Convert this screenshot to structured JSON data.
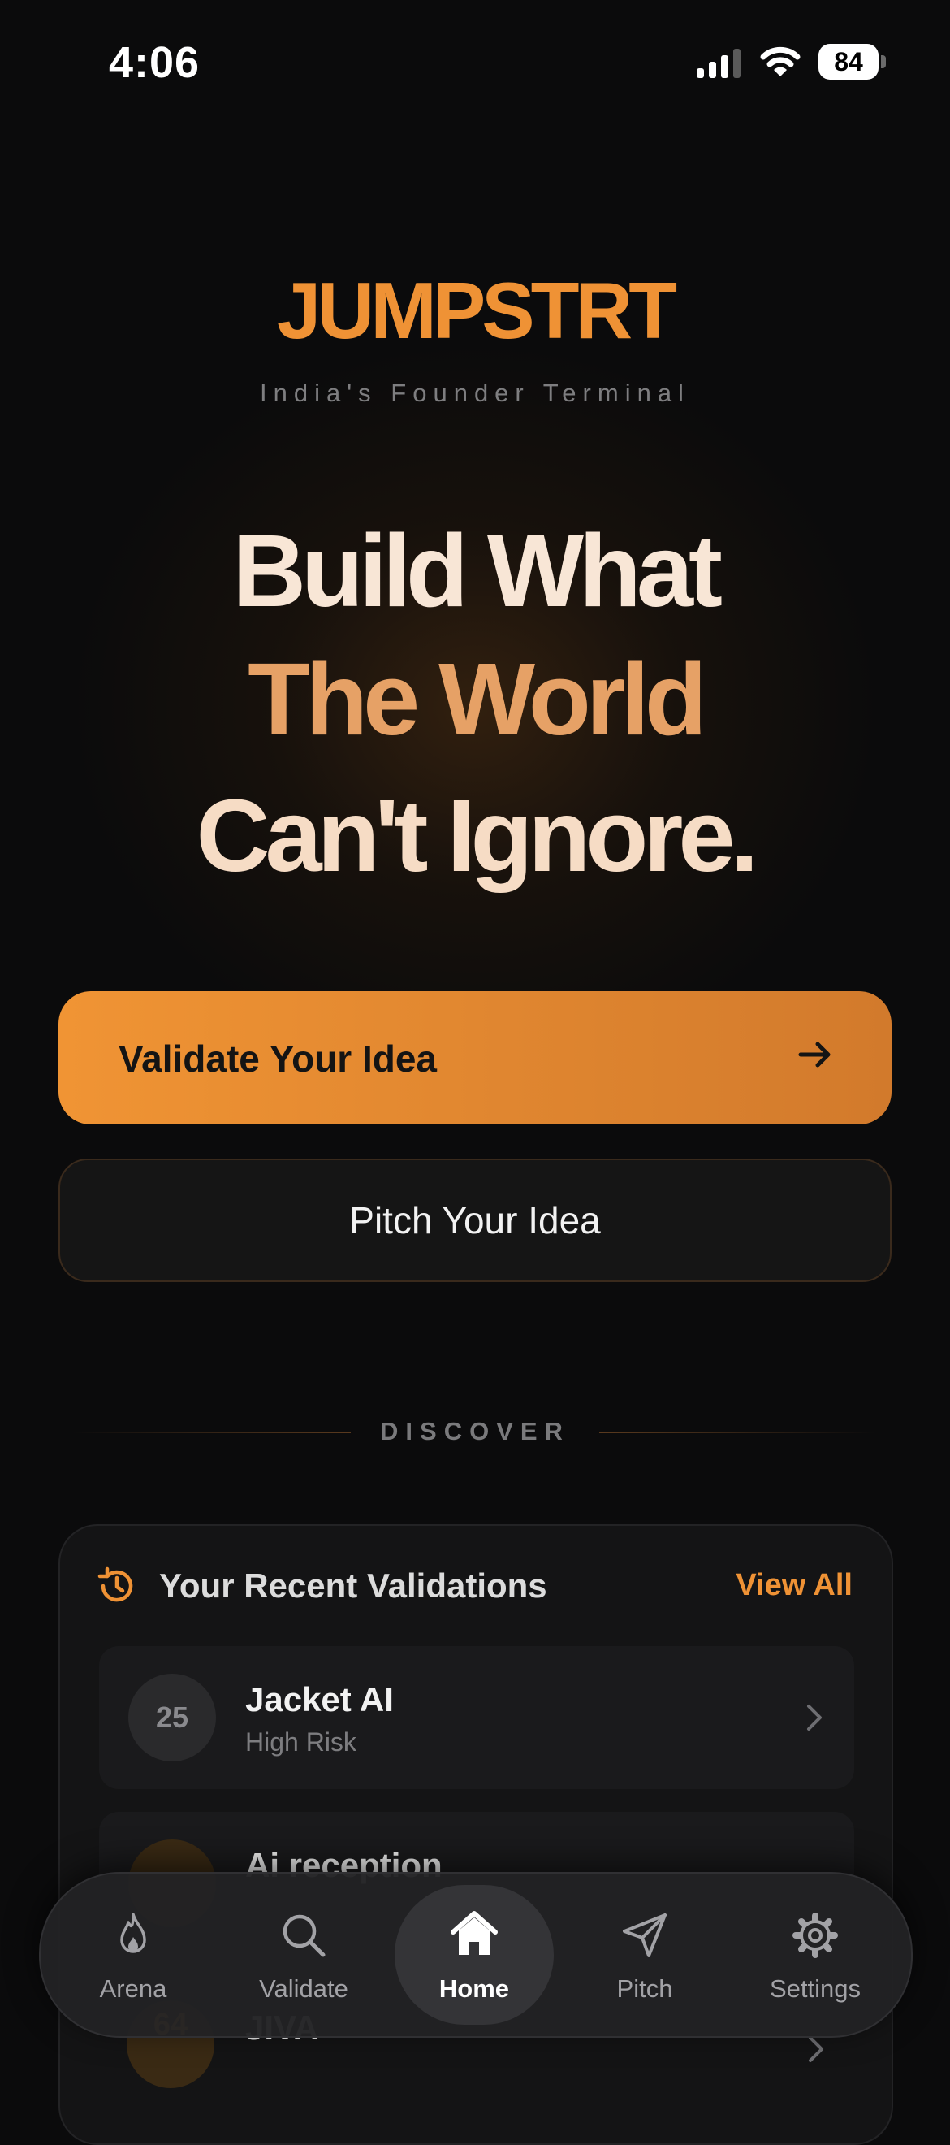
{
  "status_bar": {
    "time": "4:06",
    "battery": "84"
  },
  "brand": {
    "name": "JUMPSTRT",
    "tagline": "India's Founder Terminal"
  },
  "hero": {
    "line1": "Build What",
    "line2": "The World",
    "line3": "Can't Ignore."
  },
  "actions": {
    "primary_label": "Validate Your Idea",
    "secondary_label": "Pitch Your Idea"
  },
  "section": {
    "title": "DISCOVER"
  },
  "recent": {
    "title": "Your Recent Validations",
    "view_all": "View All",
    "items": [
      {
        "score": "25",
        "name": "Jacket AI",
        "risk": "High Risk"
      },
      {
        "score": "",
        "name": "Ai reception",
        "risk": ""
      },
      {
        "score": "64",
        "name": "JIVA",
        "risk": ""
      }
    ]
  },
  "tabbar": {
    "active": "Home",
    "tabs": [
      {
        "label": "Arena",
        "icon": "flame-icon"
      },
      {
        "label": "Validate",
        "icon": "search-icon"
      },
      {
        "label": "Home",
        "icon": "home-icon"
      },
      {
        "label": "Pitch",
        "icon": "send-icon"
      },
      {
        "label": "Settings",
        "icon": "gear-icon"
      }
    ]
  },
  "colors": {
    "accent": "#ef9235",
    "background": "#0b0b0c",
    "card": "#141415"
  }
}
